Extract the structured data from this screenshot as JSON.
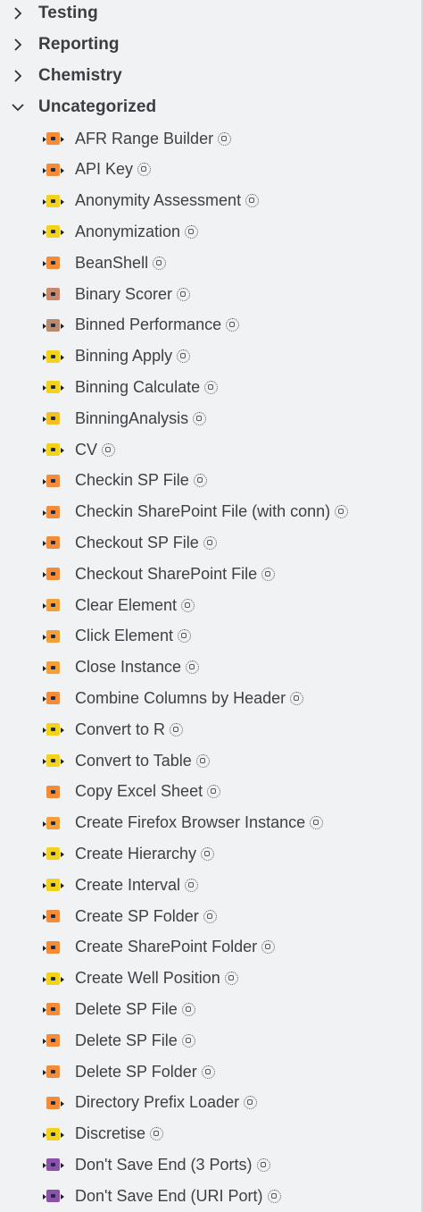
{
  "categories": [
    {
      "label": "Testing",
      "expanded": false
    },
    {
      "label": "Reporting",
      "expanded": false
    },
    {
      "label": "Chemistry",
      "expanded": false
    },
    {
      "label": "Uncategorized",
      "expanded": true
    }
  ],
  "nodes": [
    {
      "label": "AFR Range Builder",
      "color": "#f28c3a",
      "ports": "lr"
    },
    {
      "label": "API Key",
      "color": "#f28c3a",
      "ports": "lr"
    },
    {
      "label": "Anonymity Assessment",
      "color": "#f2d21b",
      "ports": "lr"
    },
    {
      "label": "Anonymization",
      "color": "#f2d21b",
      "ports": "lr"
    },
    {
      "label": "BeanShell",
      "color": "#f28c3a",
      "ports": "l"
    },
    {
      "label": "Binary Scorer",
      "color": "#c9886a",
      "ports": "l"
    },
    {
      "label": "Binned Performance",
      "color": "#b88a6e",
      "ports": "lr"
    },
    {
      "label": "Binning Apply",
      "color": "#f2d21b",
      "ports": "lr"
    },
    {
      "label": "Binning Calculate",
      "color": "#f2d21b",
      "ports": "lr"
    },
    {
      "label": "BinningAnalysis",
      "color": "#f2c021",
      "ports": "l"
    },
    {
      "label": "CV",
      "color": "#f2d21b",
      "ports": "lr"
    },
    {
      "label": "Checkin SP File",
      "color": "#f28c3a",
      "ports": "l"
    },
    {
      "label": "Checkin SharePoint File (with conn)",
      "color": "#f28c3a",
      "ports": "l"
    },
    {
      "label": "Checkout SP File",
      "color": "#f28c3a",
      "ports": "l"
    },
    {
      "label": "Checkout SharePoint File",
      "color": "#f28c3a",
      "ports": "l"
    },
    {
      "label": "Clear Element",
      "color": "#f2a03a",
      "ports": "l"
    },
    {
      "label": "Click Element",
      "color": "#f2a03a",
      "ports": "l"
    },
    {
      "label": "Close Instance",
      "color": "#f2a03a",
      "ports": "l"
    },
    {
      "label": "Combine Columns by Header",
      "color": "#f28c3a",
      "ports": "l"
    },
    {
      "label": "Convert to R",
      "color": "#f2d21b",
      "ports": "lr"
    },
    {
      "label": "Convert to Table",
      "color": "#f2d21b",
      "ports": "lr"
    },
    {
      "label": "Copy Excel Sheet",
      "color": "#f28c3a",
      "ports": ""
    },
    {
      "label": "Create Firefox Browser Instance",
      "color": "#f2a03a",
      "ports": "l"
    },
    {
      "label": "Create Hierarchy",
      "color": "#f2d21b",
      "ports": "lr"
    },
    {
      "label": "Create Interval",
      "color": "#f2d21b",
      "ports": "lr"
    },
    {
      "label": "Create SP Folder",
      "color": "#f28c3a",
      "ports": "l"
    },
    {
      "label": "Create SharePoint Folder",
      "color": "#f28c3a",
      "ports": "l"
    },
    {
      "label": "Create Well Position",
      "color": "#f2d21b",
      "ports": "lr"
    },
    {
      "label": "Delete SP File",
      "color": "#f28c3a",
      "ports": "l"
    },
    {
      "label": "Delete SP File",
      "color": "#f28c3a",
      "ports": "l"
    },
    {
      "label": "Delete SP Folder",
      "color": "#f28c3a",
      "ports": "l"
    },
    {
      "label": "Directory Prefix Loader",
      "color": "#f28c3a",
      "ports": "r"
    },
    {
      "label": "Discretise",
      "color": "#f2d21b",
      "ports": "lr"
    },
    {
      "label": "Don't Save End (3 Ports)",
      "color": "#8a52a8",
      "ports": "lr"
    },
    {
      "label": "Don't Save End (URI Port)",
      "color": "#8a52a8",
      "ports": "lr"
    }
  ]
}
